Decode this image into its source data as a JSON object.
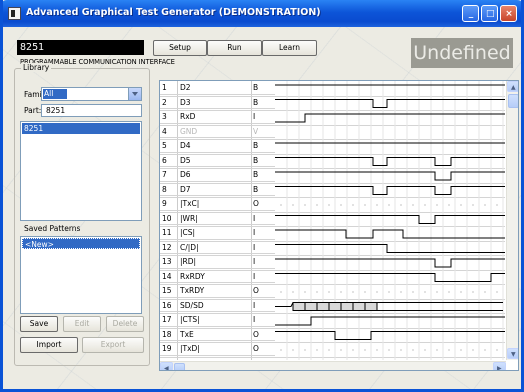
{
  "window": {
    "title": "Advanced Graphical Test Generator (DEMONSTRATION)",
    "min_glyph": "_",
    "max_glyph": "□",
    "close_glyph": "×"
  },
  "header": {
    "part_display": "8251",
    "part_description": "PROGRAMMABLE COMMUNICATION INTERFACE",
    "setup_label": "Setup",
    "run_label": "Run",
    "learn_label": "Learn",
    "status": "Undefined"
  },
  "library": {
    "group_label": "Library",
    "family_label": "Family:",
    "family_value": "All",
    "part_label": "Part:",
    "part_value": "8251",
    "parts": [
      "8251"
    ]
  },
  "patterns": {
    "label": "Saved Patterns",
    "items": [
      "<New>"
    ]
  },
  "buttons": {
    "save": "Save",
    "edit": "Edit",
    "delete": "Delete",
    "import": "Import",
    "export": "Export"
  },
  "pins": [
    {
      "n": "1",
      "name": "D2",
      "type": "B",
      "enabled": true
    },
    {
      "n": "2",
      "name": "D3",
      "type": "B",
      "enabled": true
    },
    {
      "n": "3",
      "name": "RxD",
      "type": "I",
      "enabled": true
    },
    {
      "n": "4",
      "name": "GND",
      "type": "V",
      "enabled": false
    },
    {
      "n": "5",
      "name": "D4",
      "type": "B",
      "enabled": true
    },
    {
      "n": "6",
      "name": "D5",
      "type": "B",
      "enabled": true
    },
    {
      "n": "7",
      "name": "D6",
      "type": "B",
      "enabled": true
    },
    {
      "n": "8",
      "name": "D7",
      "type": "B",
      "enabled": true
    },
    {
      "n": "9",
      "name": "|TxC|",
      "type": "O",
      "enabled": true
    },
    {
      "n": "10",
      "name": "|WR|",
      "type": "I",
      "enabled": true
    },
    {
      "n": "11",
      "name": "|CS|",
      "type": "I",
      "enabled": true
    },
    {
      "n": "12",
      "name": "C/|D|",
      "type": "I",
      "enabled": true
    },
    {
      "n": "13",
      "name": "|RD|",
      "type": "I",
      "enabled": true
    },
    {
      "n": "14",
      "name": "RxRDY",
      "type": "I",
      "enabled": true
    },
    {
      "n": "15",
      "name": "TxRDY",
      "type": "O",
      "enabled": true
    },
    {
      "n": "16",
      "name": "SD/SD",
      "type": "I",
      "enabled": true
    },
    {
      "n": "17",
      "name": "|CTS|",
      "type": "I",
      "enabled": true
    },
    {
      "n": "18",
      "name": "TxE",
      "type": "O",
      "enabled": true
    },
    {
      "n": "19",
      "name": "|TxD|",
      "type": "O",
      "enabled": true
    }
  ],
  "scroll": {
    "up": "▲",
    "down": "▼",
    "left": "◀",
    "right": "▶"
  }
}
